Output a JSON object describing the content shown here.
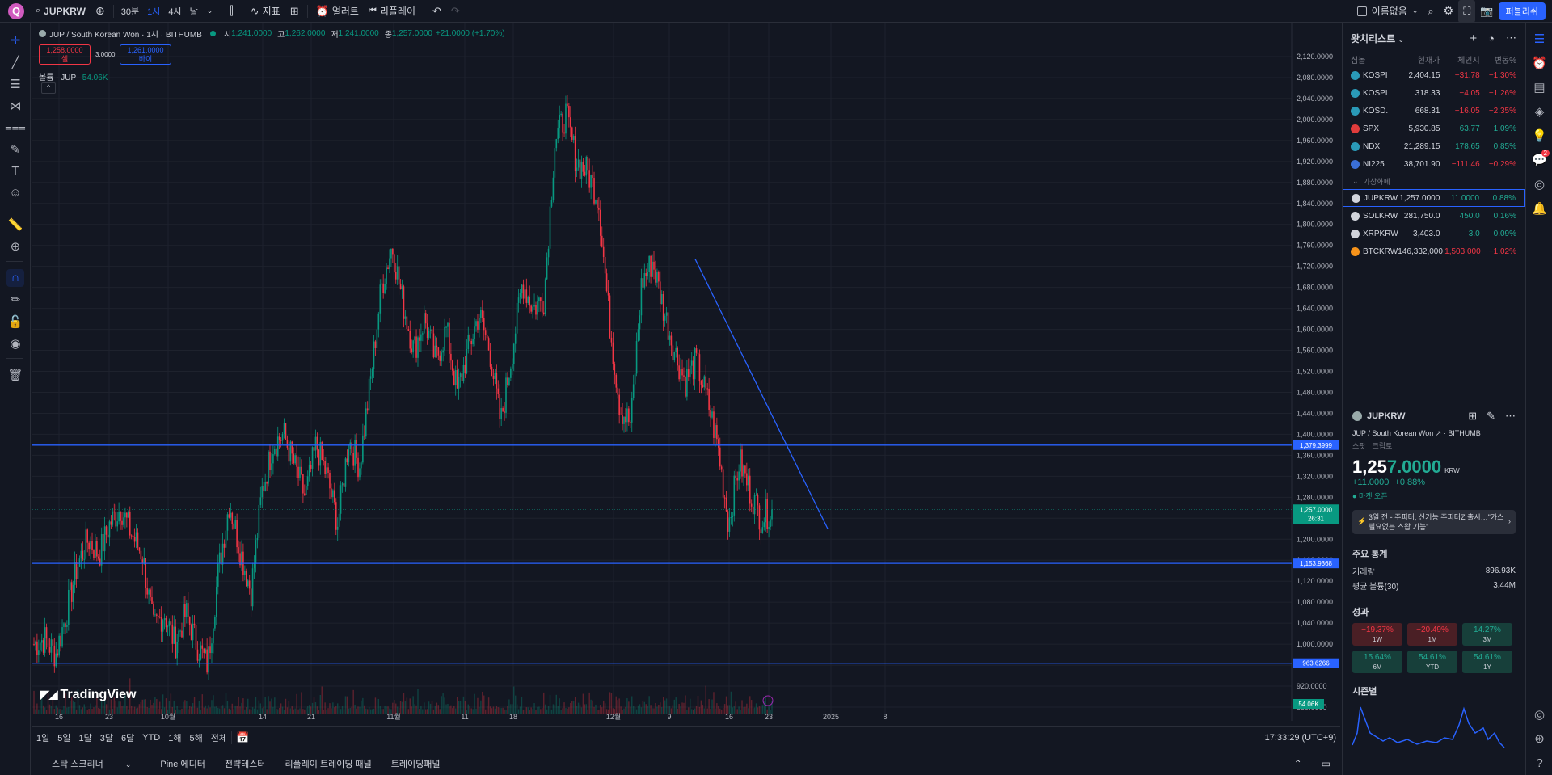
{
  "topbar": {
    "logo_letter": "Q",
    "symbol": "JUPKRW",
    "intervals": [
      "30분",
      "1시",
      "4시",
      "날"
    ],
    "indicators_label": "지표",
    "alert_label": "얼러트",
    "replay_label": "리플레이",
    "layout_name": "이름없음",
    "publish_label": "퍼블리쉬"
  },
  "legend": {
    "title": "JUP / South Korean Won · 1시 · BITHUMB",
    "o_label": "시",
    "o_val": "1,241.0000",
    "h_label": "고",
    "h_val": "1,262.0000",
    "l_label": "저",
    "l_val": "1,241.0000",
    "c_label": "종",
    "c_val": "1,257.0000",
    "change": "+21.0000 (+1.70%)",
    "sell_price": "1,258.0000",
    "sell_label": "셀",
    "spread": "3.0000",
    "buy_price": "1,261.0000",
    "buy_label": "바이",
    "volume_label": "볼륨 · JUP",
    "volume_val": "54.06K",
    "collapse_glyph": "^"
  },
  "branding": "TradingView",
  "chart_data": {
    "type": "candlestick",
    "ylim": [
      870,
      2140
    ],
    "y_ticks": [
      2120,
      2080,
      2040,
      2000,
      1960,
      1920,
      1880,
      1840,
      1800,
      1760,
      1720,
      1680,
      1640,
      1600,
      1560,
      1520,
      1480,
      1440,
      1400,
      1360,
      1320,
      1280,
      1240,
      1200,
      1160,
      1120,
      1080,
      1040,
      1000,
      960,
      920,
      880
    ],
    "y_tick_labels": [
      "2,120.0000",
      "2,080.0000",
      "2,040.0000",
      "2,000.0000",
      "1,960.0000",
      "1,920.0000",
      "1,880.0000",
      "1,840.0000",
      "1,800.0000",
      "1,760.0000",
      "1,720.0000",
      "1,680.0000",
      "1,640.0000",
      "1,600.0000",
      "1,560.0000",
      "1,520.0000",
      "1,480.0000",
      "1,440.0000",
      "1,400.0000",
      "1,360.0000",
      "1,320.0000",
      "1,280.0000",
      "1,240.0000",
      "1,200.0000",
      "1,160.0000",
      "1,120.0000",
      "1,080.0000",
      "1,040.0000",
      "1,000.0000",
      "960.0000",
      "920.0000",
      "880.0000"
    ],
    "x_tick_labels": [
      "16",
      "23",
      "10월",
      "14",
      "21",
      "11월",
      "11",
      "18",
      "12월",
      "9",
      "16",
      "23",
      "2025",
      "8"
    ],
    "close_path": [
      1000,
      1010,
      980,
      1060,
      1150,
      1200,
      1170,
      1230,
      1260,
      1210,
      1170,
      1030,
      1060,
      1000,
      1060,
      1000,
      960,
      1140,
      1270,
      1180,
      1100,
      1290,
      1380,
      1400,
      1340,
      1280,
      1380,
      1320,
      1230,
      1390,
      1340,
      1500,
      1680,
      1760,
      1650,
      1560,
      1620,
      1540,
      1600,
      1480,
      1560,
      1630,
      1560,
      1420,
      1550,
      1690,
      1640,
      1660,
      1960,
      2010,
      1920,
      1900,
      1850,
      1620,
      1450,
      1420,
      1690,
      1730,
      1640,
      1560,
      1500,
      1540,
      1470,
      1380,
      1230,
      1350,
      1290,
      1240,
      1257
    ],
    "volume_max": 196,
    "horizontal_lines": [
      {
        "price": 1379.3999,
        "label": "1,379.3999"
      },
      {
        "price": 1153.9368,
        "label": "1,153.9368"
      },
      {
        "price": 963.6266,
        "label": "963.6266"
      }
    ],
    "trendline": {
      "from": {
        "x": "12월 11일",
        "y": 1734
      },
      "to": {
        "x": "2025-01-01",
        "y": 1220
      }
    },
    "last_price_label": "1,257.0000",
    "countdown": "26:31",
    "volume_label": "54.06K",
    "colors": {
      "up": "#089981",
      "down": "#f23645",
      "line": "#2962ff",
      "grid": "#1e222d"
    }
  },
  "bottom": {
    "ranges": [
      "1일",
      "5일",
      "1달",
      "3달",
      "6달",
      "YTD",
      "1해",
      "5해",
      "전체"
    ],
    "clock": "17:33:29 (UTC+9)",
    "tabs": [
      "스탁 스크리너",
      "Pine 에디터",
      "전략테스터",
      "리플레이 트레이딩 패널",
      "트레이딩패널"
    ]
  },
  "watchlist": {
    "title": "왓치리스트",
    "columns": [
      "심볼",
      "현재가",
      "체인지",
      "변동%"
    ],
    "rows": [
      {
        "sym": "KOSPI",
        "last": "2,404.15",
        "chg": "−31.78",
        "pct": "−1.30%",
        "dir": "neg",
        "color": "#2a9ab8"
      },
      {
        "sym": "KOSPI",
        "last": "318.33",
        "chg": "−4.05",
        "pct": "−1.26%",
        "dir": "neg",
        "color": "#2a9ab8"
      },
      {
        "sym": "KOSD.",
        "last": "668.31",
        "chg": "−16.05",
        "pct": "−2.35%",
        "dir": "neg",
        "color": "#2a9ab8"
      },
      {
        "sym": "SPX",
        "last": "5,930.85",
        "chg": "63.77",
        "pct": "1.09%",
        "dir": "pos",
        "color": "#e03c3c"
      },
      {
        "sym": "NDX",
        "last": "21,289.15",
        "chg": "178.65",
        "pct": "0.85%",
        "dir": "pos",
        "color": "#2a9ab8"
      },
      {
        "sym": "NI225",
        "last": "38,701.90",
        "chg": "−111.46",
        "pct": "−0.29%",
        "dir": "neg",
        "color": "#3a6fd8"
      }
    ],
    "section": "가상화폐",
    "crypto": [
      {
        "sym": "JUPKRW",
        "last": "1,257.0000",
        "chg": "11.0000",
        "pct": "0.88%",
        "dir": "pos",
        "color": "#d1d4dc"
      },
      {
        "sym": "SOLKRW",
        "last": "281,750.0",
        "chg": "450.0",
        "pct": "0.16%",
        "dir": "pos",
        "color": "#d1d4dc"
      },
      {
        "sym": "XRPKRW",
        "last": "3,403.0",
        "chg": "3.0",
        "pct": "0.09%",
        "dir": "pos",
        "color": "#d1d4dc"
      },
      {
        "sym": "BTCKRW",
        "last": "146,332,000",
        "chg": "−1,503,000",
        "pct": "−1.02%",
        "dir": "neg",
        "color": "#f7931a"
      }
    ]
  },
  "details": {
    "symbol": "JUPKRW",
    "full_name": "JUP / South Korean Won",
    "exchange": "BITHUMB",
    "type": "스팟 · 크립토",
    "price_main": "1,25",
    "price_tail": "7.0000",
    "currency": "KRW",
    "change": "+11.0000",
    "change_pct": "+0.88%",
    "market_status": "마켓 오픈",
    "news": "3일 전 - 주피터, 신기능 주피터Z 출시…\"가스 필요없는 스왑 기능\"",
    "stats_title": "주요 통계",
    "volume_label": "거래량",
    "volume_val": "896.93K",
    "avg_volume_label": "평균 볼륨(30)",
    "avg_volume_val": "3.44M",
    "perf_title": "성과",
    "perf": [
      {
        "val": "−19.37%",
        "period": "1W",
        "dir": "n"
      },
      {
        "val": "−20.49%",
        "period": "1M",
        "dir": "n"
      },
      {
        "val": "14.27%",
        "period": "3M",
        "dir": "p"
      },
      {
        "val": "15.64%",
        "period": "6M",
        "dir": "p"
      },
      {
        "val": "54.61%",
        "period": "YTD",
        "dir": "p"
      },
      {
        "val": "54.61%",
        "period": "1Y",
        "dir": "p"
      }
    ],
    "seasonal_title": "시즌별"
  },
  "alerts_badge": "2"
}
